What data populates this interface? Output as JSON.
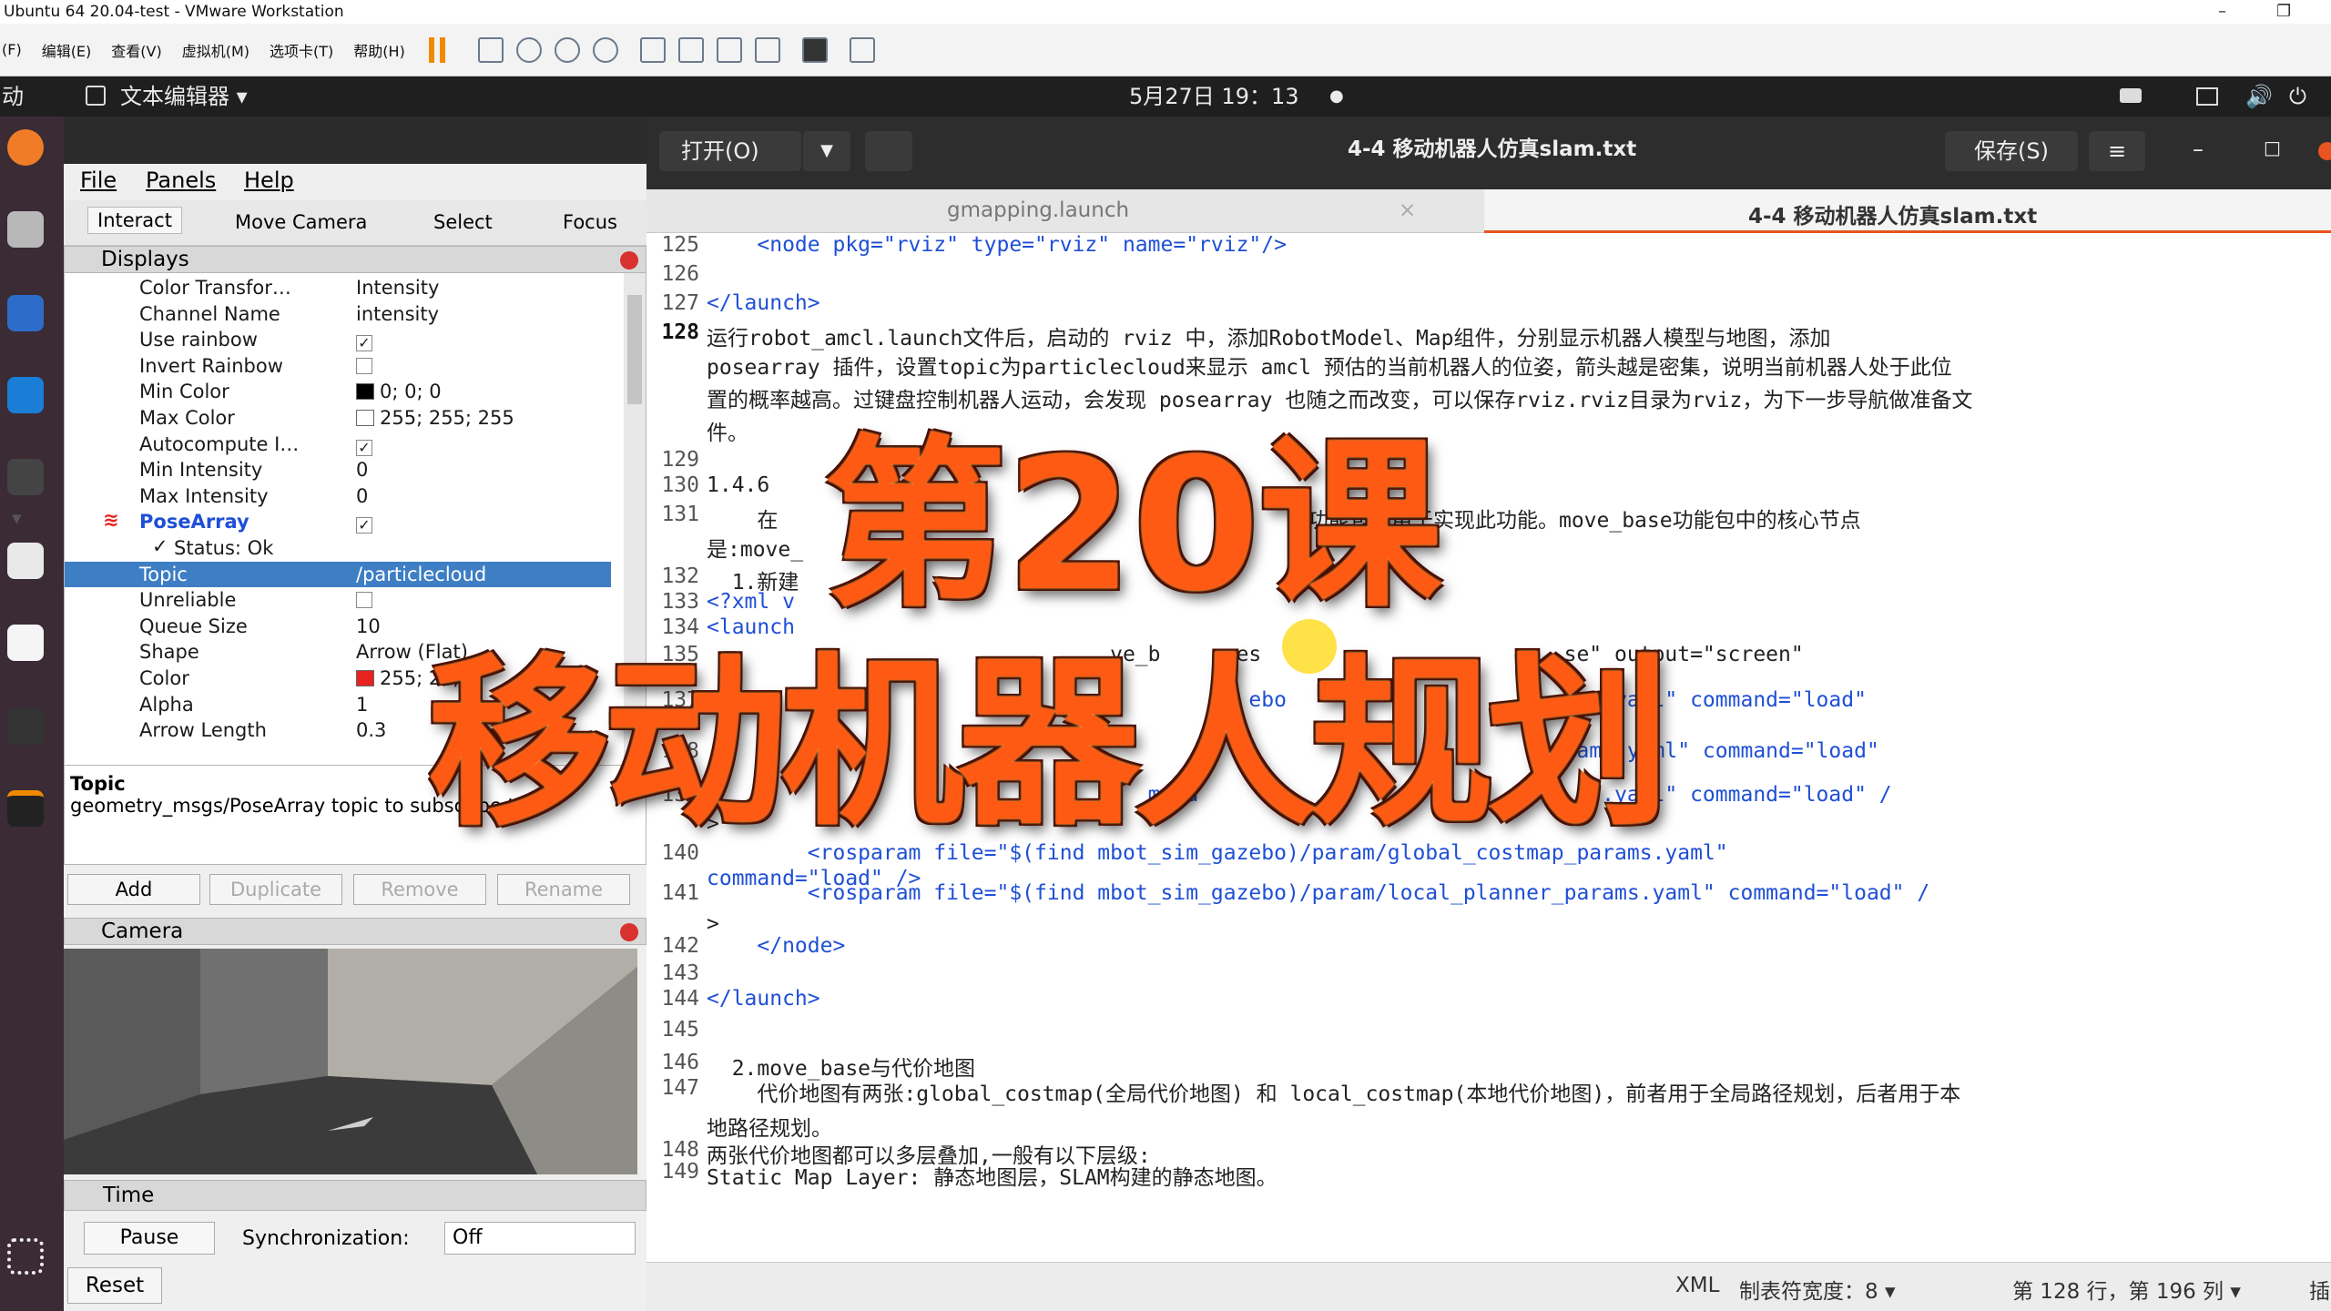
{
  "vmware": {
    "title": "Ubuntu 64 20.04-test - VMware Workstation",
    "menus": [
      "(F)",
      "编辑(E)",
      "查看(V)",
      "虚拟机(M)",
      "选项卡(T)",
      "帮助(H)"
    ],
    "minimize": "–",
    "restore": "❐"
  },
  "ubuntu": {
    "activities": "动",
    "app_menu": "文本编辑器 ▾",
    "clock": "5月27日 19：13",
    "record_dot": "●"
  },
  "rviz": {
    "menu": {
      "file": "File",
      "panels": "Panels",
      "help": "Help"
    },
    "tools": {
      "interact": "Interact",
      "move_camera": "Move Camera",
      "select": "Select",
      "focus": "Focus"
    },
    "displays_title": "Displays",
    "rows": [
      {
        "k": "Color Transfor…",
        "v": "Intensity"
      },
      {
        "k": "Channel Name",
        "v": "intensity"
      },
      {
        "k": "Use rainbow",
        "v": "✓"
      },
      {
        "k": "Invert Rainbow",
        "v": ""
      },
      {
        "k": "Min Color",
        "v": "0; 0; 0",
        "swatch": "#000000"
      },
      {
        "k": "Max Color",
        "v": "255; 255; 255",
        "swatch": "#ffffff"
      },
      {
        "k": "Autocompute I…",
        "v": "✓"
      },
      {
        "k": "Min Intensity",
        "v": "0"
      },
      {
        "k": "Max Intensity",
        "v": "0"
      },
      {
        "k": "PoseArray",
        "v": "✓"
      },
      {
        "k": "Status: Ok",
        "v": ""
      },
      {
        "k": "Topic",
        "v": "/particlecloud"
      },
      {
        "k": "Unreliable",
        "v": ""
      },
      {
        "k": "Queue Size",
        "v": "10"
      },
      {
        "k": "Shape",
        "v": "Arrow (Flat)"
      },
      {
        "k": "Color",
        "v": "255; 25; 0",
        "swatch": "#e8221e"
      },
      {
        "k": "Alpha",
        "v": "1"
      },
      {
        "k": "Arrow Length",
        "v": "0.3"
      }
    ],
    "desc_title": "Topic",
    "desc_text": "geometry_msgs/PoseArray topic to subscribe to.",
    "buttons": {
      "add": "Add",
      "duplicate": "Duplicate",
      "remove": "Remove",
      "rename": "Rename"
    },
    "camera_title": "Camera",
    "time_title": "Time",
    "pause": "Pause",
    "sync_label": "Synchronization:",
    "sync_value": "Off",
    "reset": "Reset"
  },
  "gedit": {
    "open": "打开(O)",
    "title": "4-4 移动机器人仿真slam.txt",
    "save": "保存(S)",
    "tabs": [
      "gmapping.launch",
      "4-4 移动机器人仿真slam.txt"
    ],
    "lines": [
      {
        "n": "125",
        "t": "    <node pkg=\"rviz\" type=\"rviz\" name=\"rviz\"/>"
      },
      {
        "n": "126",
        "t": ""
      },
      {
        "n": "127",
        "t": "</launch>"
      },
      {
        "n": "128",
        "t": "运行robot_amcl.launch文件后，启动的 rviz 中，添加RobotModel、Map组件，分别显示机器人模型与地图，添加"
      },
      {
        "n": "",
        "t": "posearray 插件，设置topic为particlecloud来显示 amcl 预估的当前机器人的位姿，箭头越是密集，说明当前机器人处于此位"
      },
      {
        "n": "",
        "t": "置的概率越高。过键盘控制机器人运动，会发现 posearray 也随之而改变，可以保存rviz.rviz目录为rviz，为下一步导航做准备文"
      },
      {
        "n": "",
        "t": "件。"
      },
      {
        "n": "129",
        "t": ""
      },
      {
        "n": "130",
        "t": "1.4.6 "
      },
      {
        "n": "131",
        "t": "    在                                          功能包，用于实现此功能。move_base功能包中的核心节点"
      },
      {
        "n": "",
        "t": "是:move_"
      },
      {
        "n": "132",
        "t": "  1.新建"
      },
      {
        "n": "133",
        "t": "<?xml v"
      },
      {
        "n": "134",
        "t": "<launch"
      },
      {
        "n": "135",
        "t": "                                ve_b     res                        se\" output=\"screen\""
      },
      {
        "n": "",
        "t": ""
      },
      {
        "n": "137",
        "t": "                                           ebo                      ams.yaml\" command=\"load\""
      },
      {
        "n": "",
        "t": ""
      },
      {
        "n": "138",
        "t": "                                          )                          ams.yaml\" command=\"load\""
      },
      {
        "n": "",
        "t": ""
      },
      {
        "n": "139",
        "t": "                                   m_ga                              ms.yaml\" command=\"load\" /"
      },
      {
        "n": "",
        "t": ">"
      },
      {
        "n": "140",
        "t": "        <rosparam file=\"$(find mbot_sim_gazebo)/param/global_costmap_params.yaml\""
      },
      {
        "n": "",
        "t": "command=\"load\" />"
      },
      {
        "n": "141",
        "t": "        <rosparam file=\"$(find mbot_sim_gazebo)/param/local_planner_params.yaml\" command=\"load\" /"
      },
      {
        "n": "",
        "t": ">"
      },
      {
        "n": "142",
        "t": "    </node>"
      },
      {
        "n": "143",
        "t": ""
      },
      {
        "n": "144",
        "t": "</launch>"
      },
      {
        "n": "145",
        "t": ""
      },
      {
        "n": "146",
        "t": "  2.move_base与代价地图"
      },
      {
        "n": "147",
        "t": "    代价地图有两张:global_costmap(全局代价地图) 和 local_costmap(本地代价地图)，前者用于全局路径规划，后者用于本"
      },
      {
        "n": "",
        "t": "地路径规划。"
      },
      {
        "n": "148",
        "t": "两张代价地图都可以多层叠加,一般有以下层级:"
      },
      {
        "n": "149",
        "t": "Static Map Layer: 静态地图层，SLAM构建的静态地图。"
      }
    ],
    "status": {
      "lang": "XML",
      "tab_width": "制表符宽度：8 ▾",
      "position": "第 128 行，第 196 列 ▾",
      "ins": "插"
    }
  },
  "overlay": {
    "line1": "第20课",
    "line2": "移动机器人规划"
  }
}
